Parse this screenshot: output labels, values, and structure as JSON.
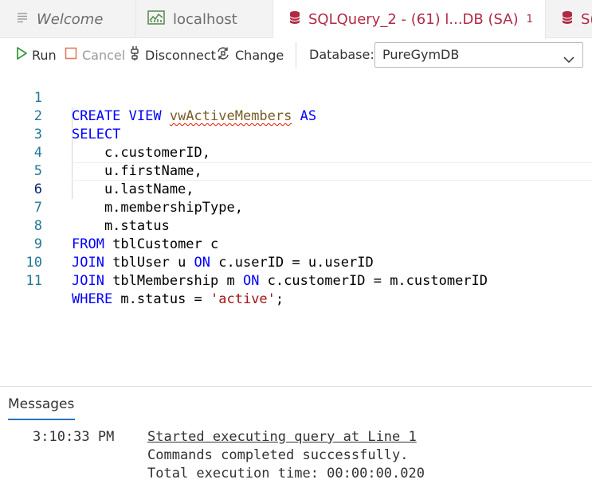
{
  "tabs": [
    {
      "label": "Welcome",
      "icon": "list-icon"
    },
    {
      "label": "localhost",
      "icon": "dashboard-icon"
    },
    {
      "label": "SQLQuery_2 - (61) l...DB (SA)",
      "icon": "database-icon",
      "count": "1",
      "dirty": true
    },
    {
      "label": "S(",
      "icon": "database-icon"
    }
  ],
  "toolbar": {
    "run_label": "Run",
    "cancel_label": "Cancel",
    "disconnect_label": "Disconnect",
    "change_label": "Change",
    "database_label": "Database:",
    "database_value": "PureGymDB"
  },
  "editor": {
    "current_line": "6",
    "lines": [
      {
        "num": "1",
        "kw1": "CREATE VIEW",
        "sp": " ",
        "name": "vwActiveMembers",
        "sp2": " ",
        "kw2": "AS"
      },
      {
        "num": "2",
        "kw": "SELECT"
      },
      {
        "num": "3",
        "text": "    c.customerID,"
      },
      {
        "num": "4",
        "text": "    u.firstName,"
      },
      {
        "num": "5",
        "text": "    u.lastName,"
      },
      {
        "num": "6",
        "text": "    m.membershipType,"
      },
      {
        "num": "7",
        "text": "    m.status"
      },
      {
        "num": "8",
        "kw": "FROM",
        "rest": " tblCustomer c"
      },
      {
        "num": "9",
        "kw": "JOIN",
        "mid": " tblUser u ",
        "kw2": "ON",
        "rest": " c.userID = u.userID"
      },
      {
        "num": "10",
        "kw": "JOIN",
        "mid": " tblMembership m ",
        "kw2": "ON",
        "rest": " c.customerID = m.customerID"
      },
      {
        "num": "11",
        "kw": "WHERE",
        "mid": " m.status = ",
        "str": "'active'",
        "rest": ";"
      }
    ]
  },
  "messages": {
    "tab_label": "Messages",
    "time": "3:10:33 PM",
    "link_text": "Started executing query at Line 1",
    "line2": "Commands completed successfully.",
    "line3": "Total execution time: 00:00:00.020"
  },
  "colors": {
    "accent": "#b02a45",
    "keyword": "#0000ff",
    "string": "#a31515",
    "line_number": "#237893"
  }
}
